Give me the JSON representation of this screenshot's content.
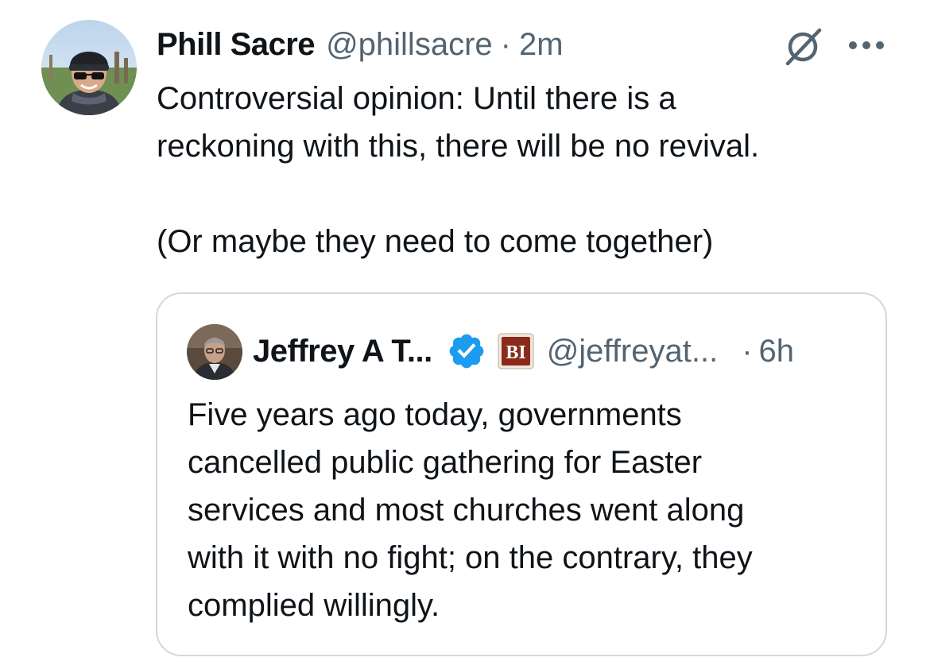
{
  "tweet": {
    "author": {
      "display_name": "Phill Sacre",
      "handle": "@phillsacre",
      "avatar_icon": "profile-photo-avatar"
    },
    "separator": "·",
    "time": "2m",
    "text_paragraphs": [
      "Controversial opinion: Until there is a\nreckoning with this, there will be no revival.",
      "(Or maybe they need to come together)"
    ],
    "actions": {
      "grok_icon": "grok-icon",
      "more_icon": "more-icon"
    }
  },
  "quote": {
    "author": {
      "display_name": "Jeffrey A T...",
      "handle": "@jeffreyat...",
      "verified_icon": "verified-badge-icon",
      "affiliate_badge_text": "BI"
    },
    "separator": "·",
    "time": "6h",
    "text": "Five years ago today, governments\ncancelled public gathering for Easter\nservices and most churches went along\nwith it with no fight; on the contrary, they\ncomplied willingly."
  },
  "colors": {
    "text_primary": "#0f1419",
    "text_secondary": "#536471",
    "verified_blue": "#1d9bf0",
    "border": "#cfd9de",
    "affiliate_badge": "#8b2a1a"
  }
}
